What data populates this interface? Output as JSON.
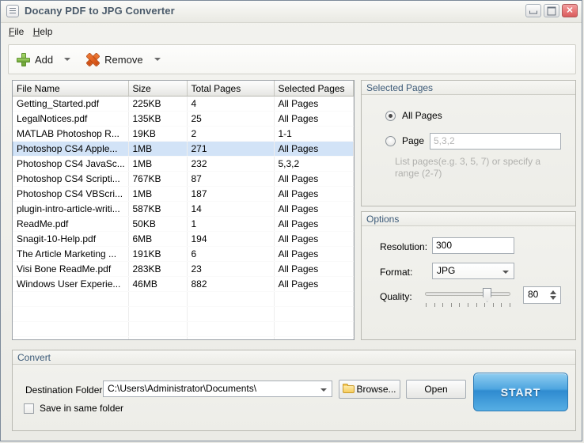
{
  "window": {
    "title": "Docany PDF to JPG Converter",
    "icon": "app-menu-icon",
    "minimize_label": "",
    "maximize_label": "",
    "close_label": "✕"
  },
  "menubar": {
    "items": [
      {
        "label": "File"
      },
      {
        "label": "Help"
      }
    ]
  },
  "toolbar": {
    "add_label": "Add",
    "add_icon": "plus-icon",
    "remove_label": "Remove",
    "remove_icon": "x-icon"
  },
  "filelist": {
    "columns": [
      "File Name",
      "Size",
      "Total Pages",
      "Selected Pages"
    ],
    "rows": [
      {
        "name": "Getting_Started.pdf",
        "size": "225KB",
        "total": "4",
        "selected": "All Pages",
        "is_selected": false
      },
      {
        "name": "LegalNotices.pdf",
        "size": "135KB",
        "total": "25",
        "selected": "All Pages",
        "is_selected": false
      },
      {
        "name": "MATLAB Photoshop R...",
        "size": "19KB",
        "total": "2",
        "selected": "1-1",
        "is_selected": false
      },
      {
        "name": "Photoshop CS4 Apple...",
        "size": "1MB",
        "total": "271",
        "selected": "All Pages",
        "is_selected": true
      },
      {
        "name": "Photoshop CS4 JavaSc...",
        "size": "1MB",
        "total": "232",
        "selected": "5,3,2",
        "is_selected": false
      },
      {
        "name": "Photoshop CS4 Scripti...",
        "size": "767KB",
        "total": "87",
        "selected": "All Pages",
        "is_selected": false
      },
      {
        "name": "Photoshop CS4 VBScri...",
        "size": "1MB",
        "total": "187",
        "selected": "All Pages",
        "is_selected": false
      },
      {
        "name": "plugin-intro-article-writi...",
        "size": "587KB",
        "total": "14",
        "selected": "All Pages",
        "is_selected": false
      },
      {
        "name": "ReadMe.pdf",
        "size": "50KB",
        "total": "1",
        "selected": "All Pages",
        "is_selected": false
      },
      {
        "name": "Snagit-10-Help.pdf",
        "size": "6MB",
        "total": "194",
        "selected": "All Pages",
        "is_selected": false
      },
      {
        "name": "The Article Marketing ...",
        "size": "191KB",
        "total": "6",
        "selected": "All Pages",
        "is_selected": false
      },
      {
        "name": "Visi Bone ReadMe.pdf",
        "size": "283KB",
        "total": "23",
        "selected": "All Pages",
        "is_selected": false
      },
      {
        "name": "Windows User Experie...",
        "size": "46MB",
        "total": "882",
        "selected": "All Pages",
        "is_selected": false
      }
    ],
    "empty_row_count": 5
  },
  "selected_pages": {
    "title": "Selected Pages",
    "all_pages_label": "All Pages",
    "all_pages_checked": true,
    "page_label": "Page",
    "page_checked": false,
    "page_placeholder": "5,3,2",
    "page_value": "",
    "hint": "List pages(e.g. 3, 5, 7)  or specify a  range (2-7)"
  },
  "options": {
    "title": "Options",
    "resolution_label": "Resolution:",
    "resolution_value": "300",
    "format_label": "Format:",
    "format_value": "JPG",
    "quality_label": "Quality:",
    "quality_value": "80"
  },
  "convert": {
    "title": "Convert",
    "destination_label": "Destination Folder:",
    "destination_value": "C:\\Users\\Administrator\\Documents\\",
    "browse_label": "Browse...",
    "browse_icon": "folder-icon",
    "open_label": "Open",
    "save_same_folder_label": "Save in same folder",
    "save_same_folder_checked": false,
    "start_label": "START"
  }
}
